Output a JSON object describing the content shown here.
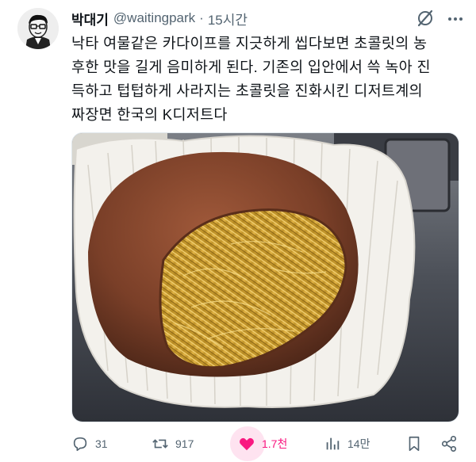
{
  "tweet": {
    "author_name": "박대기",
    "handle": "@waitingpark",
    "separator": "·",
    "time": "15시간",
    "text": "낙타 여물같은 카다이프를 지긋하게 씹다보면 초콜릿의 농\n후한 맛을 길게 음미하게 된다. 기존의 입안에서 쓱 녹아 진\n득하고 텁텁하게 사라지는 초콜릿을 진화시킨 디저트계의\n짜장면 한국의 K디저트다"
  },
  "actions": {
    "replies": "31",
    "retweets": "917",
    "likes": "1.7천",
    "views": "14만"
  },
  "colors": {
    "text": "#0f1419",
    "secondary": "#536471",
    "like": "#f91880"
  },
  "icons": [
    "grok-icon",
    "more-icon",
    "reply-icon",
    "retweet-icon",
    "heart-icon",
    "views-icon",
    "bookmark-icon",
    "share-icon"
  ]
}
